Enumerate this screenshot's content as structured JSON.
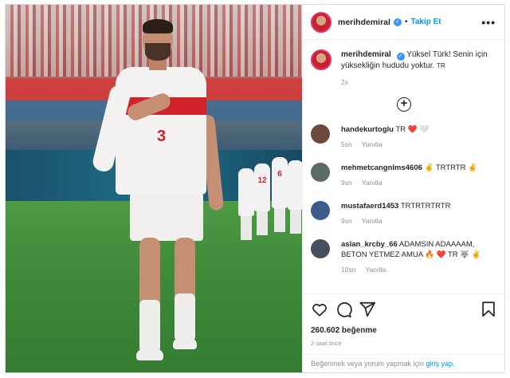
{
  "header": {
    "username": "merihdemiral",
    "follow_label": "Takip Et",
    "more_label": "•••",
    "separator": "•"
  },
  "caption": {
    "username": "merihdemiral",
    "text": "Yüksel Türk! Senin için yüksekliğin hududu yoktur.",
    "suffix": "TR",
    "age": "2s"
  },
  "load_more_label": "+",
  "comments": [
    {
      "username": "handekurtoglu",
      "text": "TR ❤️ 🤍",
      "age": "5sn",
      "reply_label": "Yanıtla",
      "avatar_color": "#6b4a3c"
    },
    {
      "username": "mehmetcangnlms4606",
      "text": "✌ TRTRTR ✌",
      "age": "9sn",
      "reply_label": "Yanıtla",
      "avatar_color": "#5b6b66"
    },
    {
      "username": "mustafaerd1453",
      "text": "TRTRTRTRTR",
      "age": "9sn",
      "reply_label": "Yanıtla",
      "avatar_color": "#3c5a8a"
    },
    {
      "username": "aslan_krcby_66",
      "text": "ADAMSIN ADAAAAM, BETON YETMEZ AMUA 🔥 ❤️ TR 🐺 ✌",
      "age": "10sn",
      "reply_label": "Yanıtla",
      "avatar_color": "#44505e"
    }
  ],
  "actions": {
    "likes": "260.602 beğenme",
    "time": "2 saat önce",
    "login_text": "Beğenmek veya yorum yapmak için",
    "login_link": "giriş yap.",
    "icons": [
      "heart-icon",
      "comment-icon",
      "share-icon",
      "bookmark-icon"
    ]
  },
  "image": {
    "shirt_number": "3",
    "teammate_numbers": [
      "12",
      "6"
    ]
  },
  "colors": {
    "accent": "#0095f6",
    "verified": "#3897f0",
    "jersey_red": "#d2232d"
  }
}
